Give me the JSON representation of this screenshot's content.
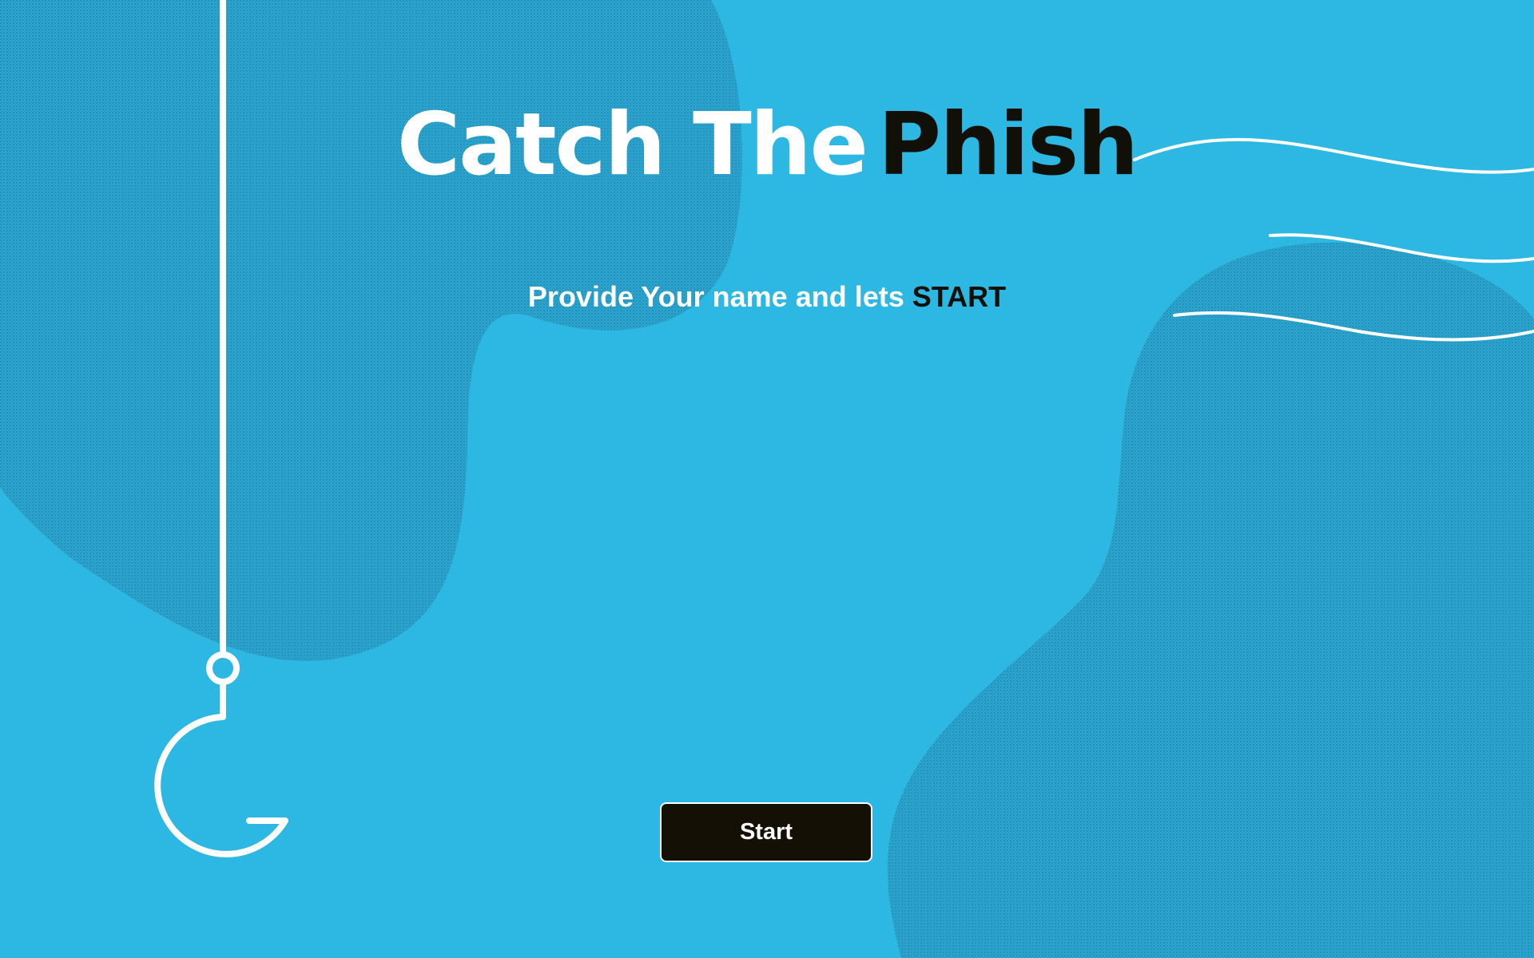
{
  "header": {
    "title_part1": "Catch The",
    "title_part2": "Phish",
    "subtitle_part1": "Provide Your name and lets ",
    "subtitle_part2": "START"
  },
  "form": {
    "start_label": "Start"
  },
  "decor": {
    "hook_icon": "fishing-hook-icon",
    "wave_icon": "wave-lines-icon"
  },
  "colors": {
    "background": "#2db7e3",
    "accent_dark": "#111008",
    "text_light": "#ffffff"
  }
}
